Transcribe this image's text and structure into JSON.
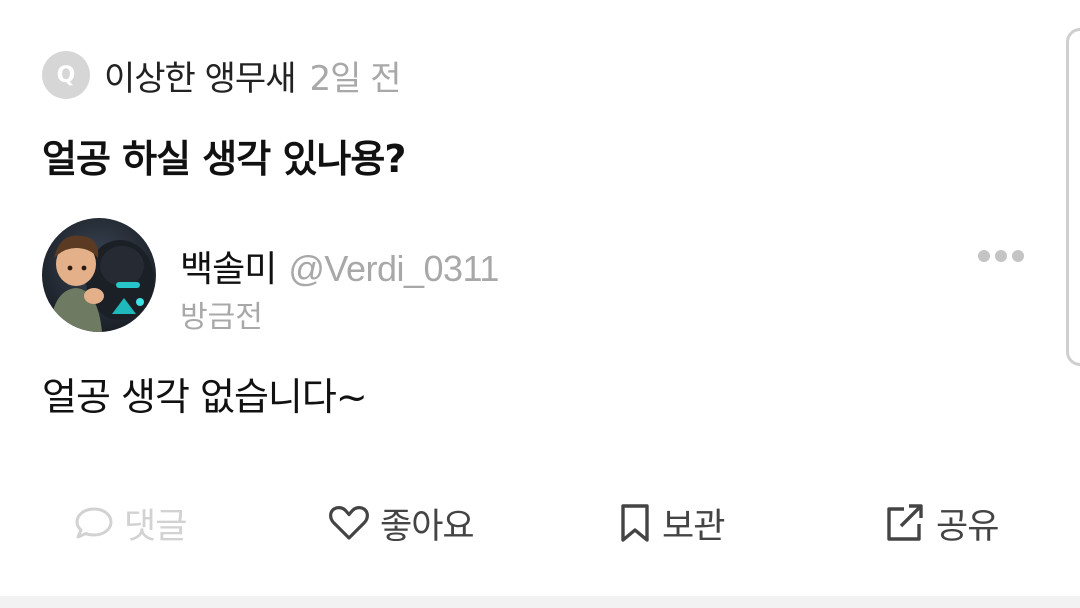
{
  "question": {
    "badge_letter": "Q",
    "asker": "이상한 앵무새",
    "time": "2일 전",
    "title": "얼공 하실 생각 있나용?"
  },
  "answer": {
    "name": "백솔미",
    "handle": "@Verdi_0311",
    "time": "방금전",
    "body": "얼공 생각 없습니다~"
  },
  "actions": {
    "comment_label": "댓글",
    "like_label": "좋아요",
    "save_label": "보관",
    "share_label": "공유"
  },
  "colors": {
    "muted_text": "#a8a8a8",
    "disabled_action": "#d2d2d2",
    "active_action": "#444444",
    "badge_bg": "#d6d6d6"
  },
  "icons": {
    "question_badge": "q-badge-icon",
    "more": "more-dots-icon",
    "comment": "speech-bubble-icon",
    "like": "heart-outline-icon",
    "save": "bookmark-outline-icon",
    "share": "share-external-icon"
  }
}
